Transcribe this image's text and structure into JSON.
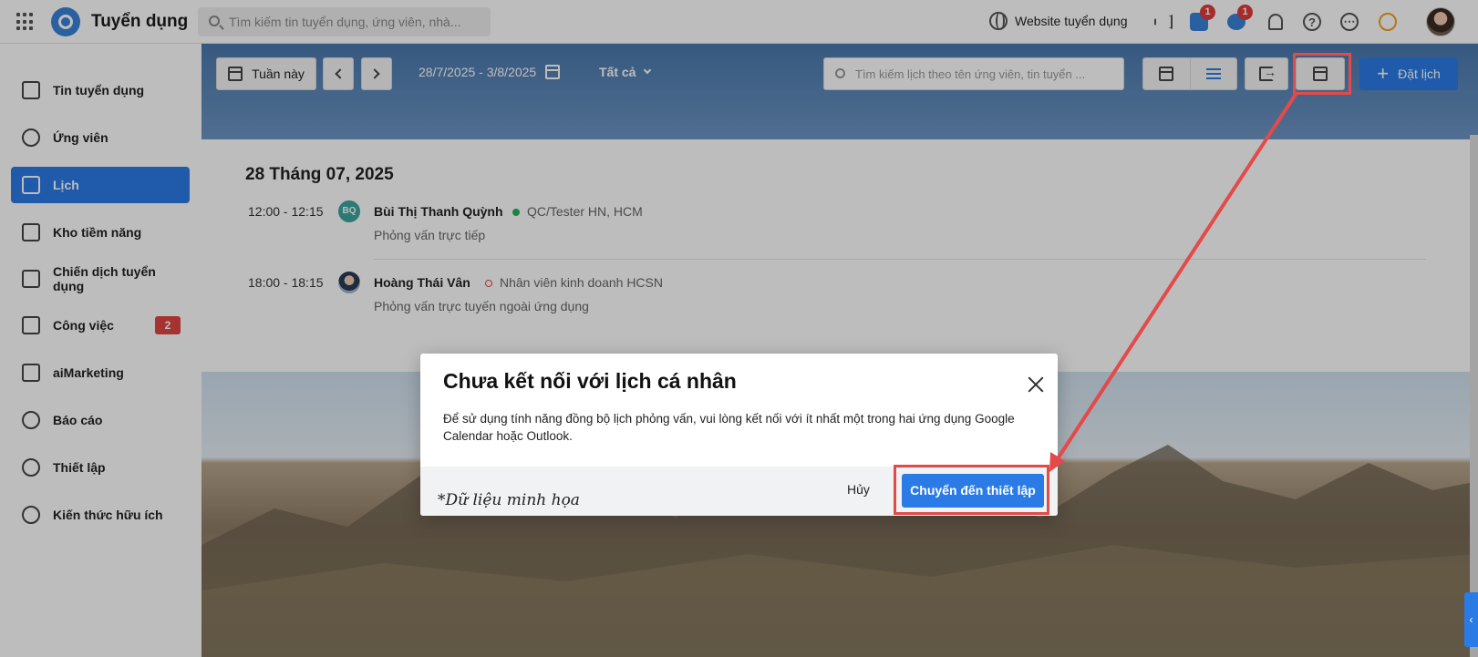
{
  "topbar": {
    "app_title": "Tuyển dụng",
    "search_placeholder": "Tìm kiếm tin tuyển dụng, ứng viên, nhà...",
    "website_link": "Website tuyển dụng",
    "cart_badge": "1",
    "chat_badge": "1",
    "icons": [
      "apps-grid-icon",
      "megaphone-icon",
      "cart-icon",
      "chat-icon",
      "bell-icon",
      "help-icon",
      "more-icon",
      "lightbulb-icon"
    ]
  },
  "sidebar": {
    "items": [
      {
        "label": "Tin tuyển dụng",
        "icon": "job-post-icon"
      },
      {
        "label": "Ứng viên",
        "icon": "candidates-icon"
      },
      {
        "label": "Lịch",
        "icon": "calendar-icon",
        "active": true
      },
      {
        "label": "Kho tiềm năng",
        "icon": "talent-pool-icon"
      },
      {
        "label": "Chiến dịch tuyển dụng",
        "icon": "campaign-icon"
      },
      {
        "label": "Công việc",
        "icon": "tasks-icon",
        "badge": "2"
      },
      {
        "label": "aiMarketing",
        "icon": "mail-icon"
      },
      {
        "label": "Báo cáo",
        "icon": "report-icon"
      },
      {
        "label": "Thiết lập",
        "icon": "settings-icon"
      },
      {
        "label": "Kiến thức hữu ích",
        "icon": "knowledge-icon"
      }
    ]
  },
  "toolbar": {
    "week_label": "Tuần này",
    "date_range": "28/7/2025 - 3/8/2025",
    "filter_label": "Tất cả",
    "search_placeholder": "Tìm kiếm lịch theo tên ứng viên, tin tuyển ...",
    "book_label": "Đặt lịch"
  },
  "schedule": {
    "day_title": "28 Tháng 07, 2025",
    "events": [
      {
        "time": "12:00 - 12:15",
        "avatar_initials": "BQ",
        "name": "Bùi Thị Thanh Quỳnh",
        "status_color": "#27ae60",
        "role": "QC/Tester HN, HCM",
        "type": "Phỏng vấn trực tiếp"
      },
      {
        "time": "18:00 - 18:15",
        "avatar_initials": "",
        "name": "Hoàng Thái Vân",
        "status_color": "#e24444",
        "role": "Nhân viên kinh doanh HCSN",
        "type": "Phỏng vấn trực tuyến ngoài ứng dụng"
      }
    ]
  },
  "dialog": {
    "title": "Chưa kết nối với lịch cá nhân",
    "body": "Để sử dụng tính năng đồng bộ lịch phỏng vấn, vui lòng kết nối với ít nhất một trong hai ứng dụng Google Calendar hoặc Outlook.",
    "note": "*Dữ liệu minh họa",
    "cancel_label": "Hủy",
    "primary_label": "Chuyển đến thiết lập"
  },
  "colors": {
    "accent": "#2b7be6",
    "annotation": "#e34a4a",
    "badge": "#e24444"
  }
}
